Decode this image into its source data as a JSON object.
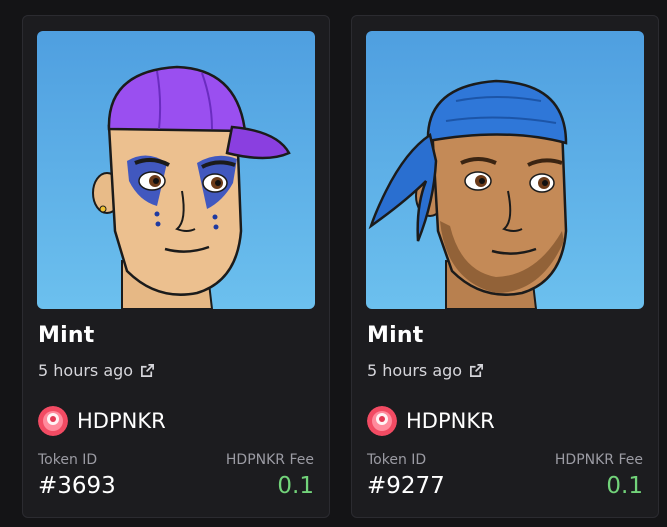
{
  "cards": [
    {
      "title": "Mint",
      "time": "5 hours ago",
      "collection": "HDPNKR",
      "token_label": "Token ID",
      "token_id": "#3693",
      "fee_label": "HDPNKR Fee",
      "fee": "0.1",
      "headwear": "purple-cap",
      "accent_color": "#8b3cf0"
    },
    {
      "title": "Mint",
      "time": "5 hours ago",
      "collection": "HDPNKR",
      "token_label": "Token ID",
      "token_id": "#9277",
      "fee_label": "HDPNKR Fee",
      "fee": "0.1",
      "headwear": "blue-bandana",
      "accent_color": "#2f77d8"
    }
  ],
  "colors": {
    "background": "#141416",
    "card": "#1c1c1f",
    "fee_green": "#72d37a",
    "art_sky": "#5fb0e8"
  },
  "icons": {
    "external_link": "external-link-icon"
  }
}
